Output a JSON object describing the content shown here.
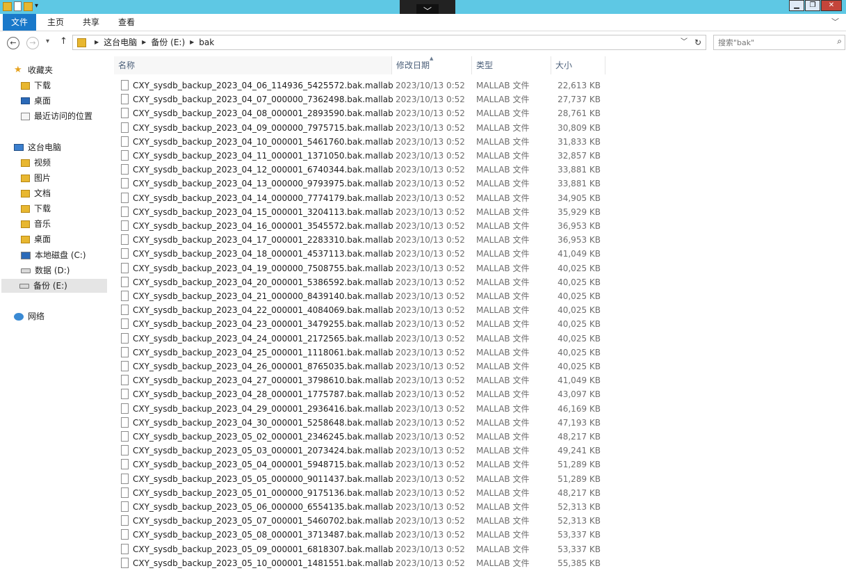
{
  "ribbon": {
    "tabs": [
      "文件",
      "主页",
      "共享",
      "查看"
    ]
  },
  "address": {
    "crumbs": [
      "这台电脑",
      "备份 (E:)",
      "bak"
    ]
  },
  "search": {
    "placeholder": "搜索\"bak\""
  },
  "sidebar": {
    "favorites": {
      "label": "收藏夹",
      "items": [
        "下载",
        "桌面",
        "最近访问的位置"
      ]
    },
    "pc": {
      "label": "这台电脑",
      "items": [
        "视频",
        "图片",
        "文档",
        "下载",
        "音乐",
        "桌面",
        "本地磁盘 (C:)",
        "数据 (D:)",
        "备份 (E:)"
      ],
      "selected": "备份 (E:)"
    },
    "network": {
      "label": "网络"
    }
  },
  "columns": {
    "name": "名称",
    "date": "修改日期",
    "type": "类型",
    "size": "大小"
  },
  "files": [
    {
      "name": "CXY_sysdb_backup_2023_04_06_114936_5425572.bak.mallab",
      "date": "2023/10/13 0:52",
      "type": "MALLAB 文件",
      "size": "22,613 KB"
    },
    {
      "name": "CXY_sysdb_backup_2023_04_07_000000_7362498.bak.mallab",
      "date": "2023/10/13 0:52",
      "type": "MALLAB 文件",
      "size": "27,737 KB"
    },
    {
      "name": "CXY_sysdb_backup_2023_04_08_000001_2893590.bak.mallab",
      "date": "2023/10/13 0:52",
      "type": "MALLAB 文件",
      "size": "28,761 KB"
    },
    {
      "name": "CXY_sysdb_backup_2023_04_09_000000_7975715.bak.mallab",
      "date": "2023/10/13 0:52",
      "type": "MALLAB 文件",
      "size": "30,809 KB"
    },
    {
      "name": "CXY_sysdb_backup_2023_04_10_000001_5461760.bak.mallab",
      "date": "2023/10/13 0:52",
      "type": "MALLAB 文件",
      "size": "31,833 KB"
    },
    {
      "name": "CXY_sysdb_backup_2023_04_11_000001_1371050.bak.mallab",
      "date": "2023/10/13 0:52",
      "type": "MALLAB 文件",
      "size": "32,857 KB"
    },
    {
      "name": "CXY_sysdb_backup_2023_04_12_000001_6740344.bak.mallab",
      "date": "2023/10/13 0:52",
      "type": "MALLAB 文件",
      "size": "33,881 KB"
    },
    {
      "name": "CXY_sysdb_backup_2023_04_13_000000_9793975.bak.mallab",
      "date": "2023/10/13 0:52",
      "type": "MALLAB 文件",
      "size": "33,881 KB"
    },
    {
      "name": "CXY_sysdb_backup_2023_04_14_000000_7774179.bak.mallab",
      "date": "2023/10/13 0:52",
      "type": "MALLAB 文件",
      "size": "34,905 KB"
    },
    {
      "name": "CXY_sysdb_backup_2023_04_15_000001_3204113.bak.mallab",
      "date": "2023/10/13 0:52",
      "type": "MALLAB 文件",
      "size": "35,929 KB"
    },
    {
      "name": "CXY_sysdb_backup_2023_04_16_000001_3545572.bak.mallab",
      "date": "2023/10/13 0:52",
      "type": "MALLAB 文件",
      "size": "36,953 KB"
    },
    {
      "name": "CXY_sysdb_backup_2023_04_17_000001_2283310.bak.mallab",
      "date": "2023/10/13 0:52",
      "type": "MALLAB 文件",
      "size": "36,953 KB"
    },
    {
      "name": "CXY_sysdb_backup_2023_04_18_000001_4537113.bak.mallab",
      "date": "2023/10/13 0:52",
      "type": "MALLAB 文件",
      "size": "41,049 KB"
    },
    {
      "name": "CXY_sysdb_backup_2023_04_19_000000_7508755.bak.mallab",
      "date": "2023/10/13 0:52",
      "type": "MALLAB 文件",
      "size": "40,025 KB"
    },
    {
      "name": "CXY_sysdb_backup_2023_04_20_000001_5386592.bak.mallab",
      "date": "2023/10/13 0:52",
      "type": "MALLAB 文件",
      "size": "40,025 KB"
    },
    {
      "name": "CXY_sysdb_backup_2023_04_21_000000_8439140.bak.mallab",
      "date": "2023/10/13 0:52",
      "type": "MALLAB 文件",
      "size": "40,025 KB"
    },
    {
      "name": "CXY_sysdb_backup_2023_04_22_000001_4084069.bak.mallab",
      "date": "2023/10/13 0:52",
      "type": "MALLAB 文件",
      "size": "40,025 KB"
    },
    {
      "name": "CXY_sysdb_backup_2023_04_23_000001_3479255.bak.mallab",
      "date": "2023/10/13 0:52",
      "type": "MALLAB 文件",
      "size": "40,025 KB"
    },
    {
      "name": "CXY_sysdb_backup_2023_04_24_000001_2172565.bak.mallab",
      "date": "2023/10/13 0:52",
      "type": "MALLAB 文件",
      "size": "40,025 KB"
    },
    {
      "name": "CXY_sysdb_backup_2023_04_25_000001_1118061.bak.mallab",
      "date": "2023/10/13 0:52",
      "type": "MALLAB 文件",
      "size": "40,025 KB"
    },
    {
      "name": "CXY_sysdb_backup_2023_04_26_000001_8765035.bak.mallab",
      "date": "2023/10/13 0:52",
      "type": "MALLAB 文件",
      "size": "40,025 KB"
    },
    {
      "name": "CXY_sysdb_backup_2023_04_27_000001_3798610.bak.mallab",
      "date": "2023/10/13 0:52",
      "type": "MALLAB 文件",
      "size": "41,049 KB"
    },
    {
      "name": "CXY_sysdb_backup_2023_04_28_000001_1775787.bak.mallab",
      "date": "2023/10/13 0:52",
      "type": "MALLAB 文件",
      "size": "43,097 KB"
    },
    {
      "name": "CXY_sysdb_backup_2023_04_29_000001_2936416.bak.mallab",
      "date": "2023/10/13 0:52",
      "type": "MALLAB 文件",
      "size": "46,169 KB"
    },
    {
      "name": "CXY_sysdb_backup_2023_04_30_000001_5258648.bak.mallab",
      "date": "2023/10/13 0:52",
      "type": "MALLAB 文件",
      "size": "47,193 KB"
    },
    {
      "name": "CXY_sysdb_backup_2023_05_02_000001_2346245.bak.mallab",
      "date": "2023/10/13 0:52",
      "type": "MALLAB 文件",
      "size": "48,217 KB"
    },
    {
      "name": "CXY_sysdb_backup_2023_05_03_000001_2073424.bak.mallab",
      "date": "2023/10/13 0:52",
      "type": "MALLAB 文件",
      "size": "49,241 KB"
    },
    {
      "name": "CXY_sysdb_backup_2023_05_04_000001_5948715.bak.mallab",
      "date": "2023/10/13 0:52",
      "type": "MALLAB 文件",
      "size": "51,289 KB"
    },
    {
      "name": "CXY_sysdb_backup_2023_05_05_000000_9011437.bak.mallab",
      "date": "2023/10/13 0:52",
      "type": "MALLAB 文件",
      "size": "51,289 KB"
    },
    {
      "name": "CXY_sysdb_backup_2023_05_01_000000_9175136.bak.mallab",
      "date": "2023/10/13 0:52",
      "type": "MALLAB 文件",
      "size": "48,217 KB"
    },
    {
      "name": "CXY_sysdb_backup_2023_05_06_000000_6554135.bak.mallab",
      "date": "2023/10/13 0:52",
      "type": "MALLAB 文件",
      "size": "52,313 KB"
    },
    {
      "name": "CXY_sysdb_backup_2023_05_07_000001_5460702.bak.mallab",
      "date": "2023/10/13 0:52",
      "type": "MALLAB 文件",
      "size": "52,313 KB"
    },
    {
      "name": "CXY_sysdb_backup_2023_05_08_000001_3713487.bak.mallab",
      "date": "2023/10/13 0:52",
      "type": "MALLAB 文件",
      "size": "53,337 KB"
    },
    {
      "name": "CXY_sysdb_backup_2023_05_09_000001_6818307.bak.mallab",
      "date": "2023/10/13 0:52",
      "type": "MALLAB 文件",
      "size": "53,337 KB"
    },
    {
      "name": "CXY_sysdb_backup_2023_05_10_000001_1481551.bak.mallab",
      "date": "2023/10/13 0:52",
      "type": "MALLAB 文件",
      "size": "55,385 KB"
    }
  ]
}
